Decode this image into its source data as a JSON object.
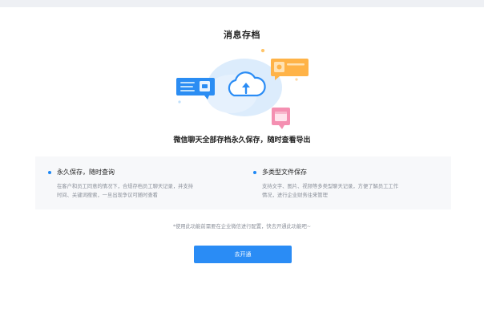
{
  "header": {
    "title": "消息存档"
  },
  "hero": {
    "subtitle": "微信聊天全部存档永久保存，随时查看导出"
  },
  "features": [
    {
      "title": "永久保存，随时查询",
      "desc_line1": "在客户和员工同意的情况下，合规存档员工聊天记录，并支持",
      "desc_line2": "时间、关键词搜索，一旦出现争议可随时查看"
    },
    {
      "title": "多类型文件保存",
      "desc_line1": "支持文字、图片、视频等多类型聊天记录，方便了解员工工作",
      "desc_line2": "情况，进行企业财务往来管理"
    }
  ],
  "footer": {
    "note": "*使用此功能前需要在企业微信进行配置，快去开通此功能吧~",
    "open_button_label": "去开通"
  },
  "colors": {
    "accent": "#2a8cf5",
    "cloud": "#d7eafc",
    "chat_blue": "#2b8df3",
    "chat_orange": "#ffb347",
    "chat_pink": "#f48fb1"
  },
  "icons": [
    "cloud-upload-icon",
    "chat-bubble-icon",
    "image-file-icon",
    "folder-file-icon"
  ]
}
